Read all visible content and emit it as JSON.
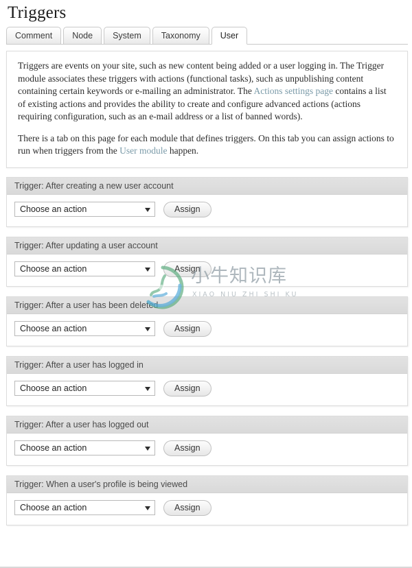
{
  "page": {
    "title": "Triggers"
  },
  "tabs": [
    {
      "label": "Comment",
      "active": false
    },
    {
      "label": "Node",
      "active": false
    },
    {
      "label": "System",
      "active": false
    },
    {
      "label": "Taxonomy",
      "active": false
    },
    {
      "label": "User",
      "active": true
    }
  ],
  "help": {
    "paragraph1_part1": "Triggers are events on your site, such as new content being added or a user logging in. The Trigger module associates these triggers with actions (functional tasks), such as unpublishing content containing certain keywords or e-mailing an administrator. The ",
    "paragraph1_link": "Actions settings page",
    "paragraph1_part2": " contains a list of existing actions and provides the ability to create and configure advanced actions (actions requiring configuration, such as an e-mail address or a list of banned words).",
    "paragraph2_part1": "There is a tab on this page for each module that defines triggers. On this tab you can assign actions to run when triggers from the ",
    "paragraph2_link": "User module",
    "paragraph2_part2": " happen."
  },
  "triggers": [
    {
      "header": "Trigger: After creating a new user account",
      "select_value": "Choose an action",
      "assign_label": "Assign"
    },
    {
      "header": "Trigger: After updating a user account",
      "select_value": "Choose an action",
      "assign_label": "Assign"
    },
    {
      "header": "Trigger: After a user has been deleted",
      "select_value": "Choose an action",
      "assign_label": "Assign"
    },
    {
      "header": "Trigger: After a user has logged in",
      "select_value": "Choose an action",
      "assign_label": "Assign"
    },
    {
      "header": "Trigger: After a user has logged out",
      "select_value": "Choose an action",
      "assign_label": "Assign"
    },
    {
      "header": "Trigger: When a user's profile is being viewed",
      "select_value": "Choose an action",
      "assign_label": "Assign"
    }
  ],
  "watermark": {
    "chinese": "小牛知识库",
    "pinyin": "XIAO NIU ZHI SHI KU"
  },
  "colors": {
    "link": "#7a9aa8",
    "header_bg": "#dedede",
    "watermark_green": "#5aab7e",
    "watermark_blue": "#4fa8d8"
  }
}
